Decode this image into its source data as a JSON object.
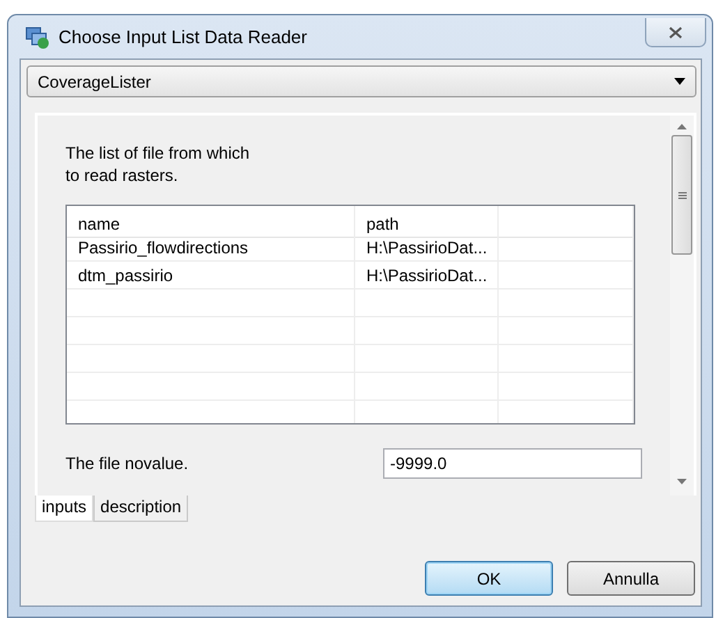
{
  "window": {
    "title": "Choose Input List Data Reader"
  },
  "reader_dropdown": {
    "value": "CoverageLister"
  },
  "description": {
    "lines": [
      "The list of file from which",
      "to read rasters."
    ]
  },
  "table": {
    "columns": [
      "name",
      "path"
    ],
    "rows": [
      [
        "Passirio_flowdirections",
        "H:\\PassirioDat..."
      ],
      [
        "dtm_passirio",
        "H:\\PassirioDat..."
      ]
    ]
  },
  "novalue": {
    "label": "The file novalue.",
    "value": "-9999.0"
  },
  "tabs": [
    {
      "label": "inputs",
      "selected": true
    },
    {
      "label": "description",
      "selected": false
    }
  ],
  "buttons": [
    {
      "label": "OK",
      "default": true
    },
    {
      "label": "Annulla",
      "default": false
    }
  ]
}
